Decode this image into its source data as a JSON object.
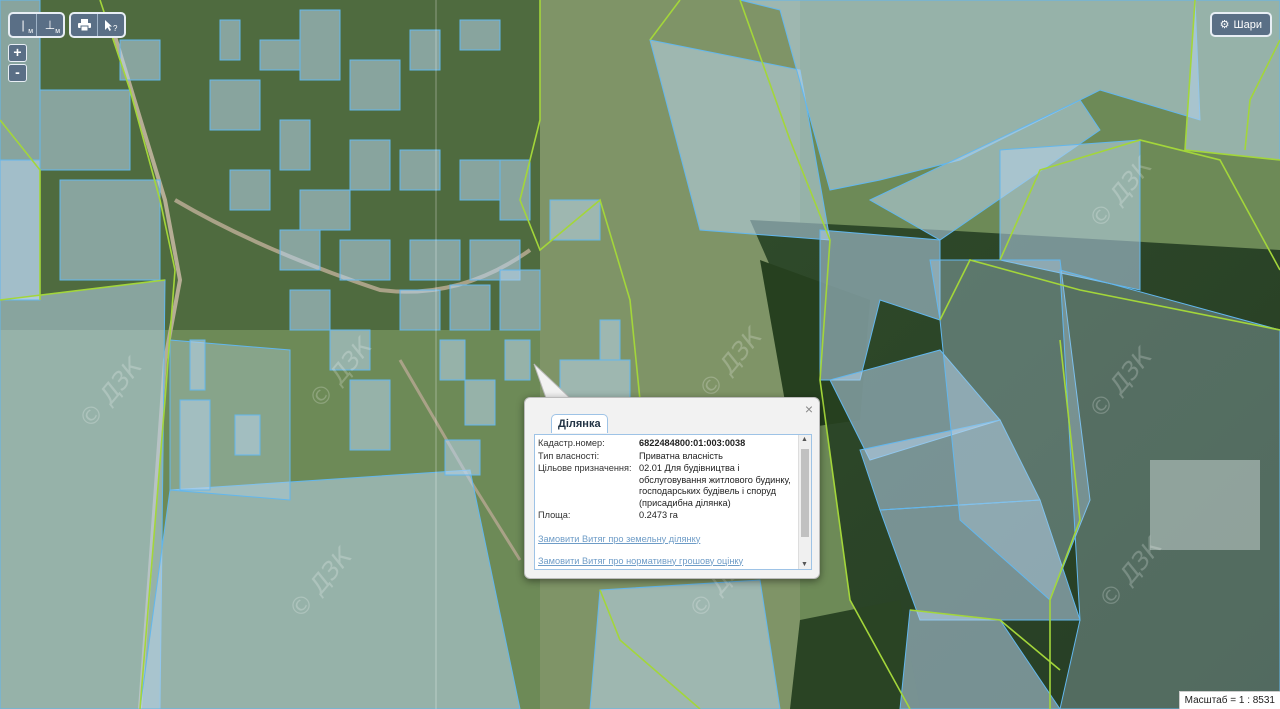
{
  "toolbar": {
    "measure_line_label": "м",
    "measure_area_label": "м",
    "print_icon": "printer-icon",
    "identify_icon": "cursor-question-icon"
  },
  "zoom": {
    "in_label": "+",
    "out_label": "-"
  },
  "layers_button": {
    "label": "Шари",
    "icon": "gear-icon"
  },
  "watermark": "© ДЗК",
  "popup": {
    "tab_title": "Ділянка",
    "close_label": "×",
    "fields": [
      {
        "label": "Кадастр.номер:",
        "value": "6822484800:01:003:0038",
        "bold": true
      },
      {
        "label": "Тип власності:",
        "value": "Приватна власність",
        "bold": false
      },
      {
        "label": "Цільове призначення:",
        "value": "02.01 Для будівництва і обслуговування житлового будинку, господарських будівель і споруд (присадибна ділянка)",
        "bold": false
      },
      {
        "label": "Площа:",
        "value": "0.2473 га",
        "bold": false
      }
    ],
    "links": [
      "Замовити Витяг про земельну ділянку",
      "Замовити Витяг про нормативну грошову оцінку"
    ]
  },
  "scale": {
    "label": "Масштаб = 1 : 8531"
  }
}
